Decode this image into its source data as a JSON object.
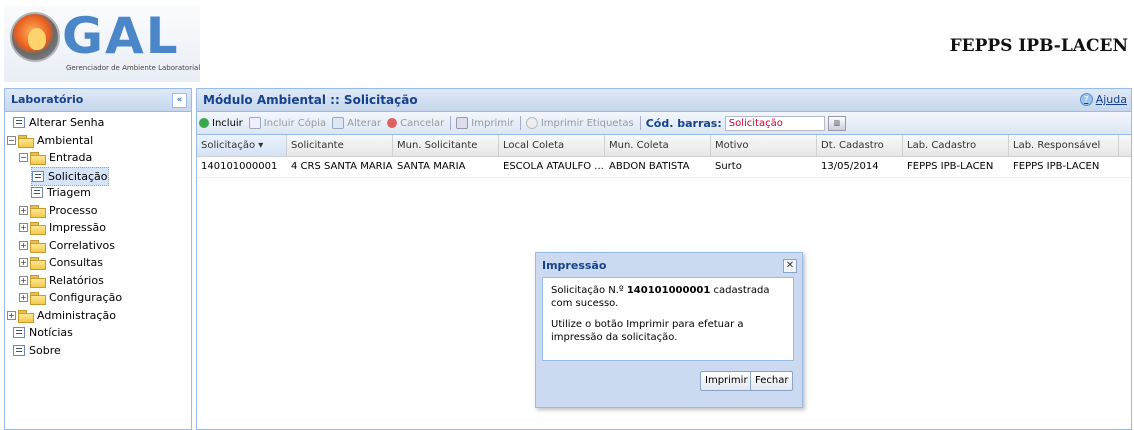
{
  "header": {
    "logo_text": "GAL",
    "logo_subtitle": "Gerenciador de Ambiente Laboratorial",
    "brand": "FEPPS IPB-LACEN"
  },
  "left_panel": {
    "title": "Laboratório",
    "collapse": "«",
    "tree": [
      {
        "label": "Alterar Senha",
        "type": "doc"
      },
      {
        "label": "Ambiental",
        "type": "folder",
        "expander": "−"
      },
      {
        "label": "Entrada",
        "type": "folder",
        "expander": "−"
      },
      {
        "label": "Solicitação",
        "type": "doc",
        "selected": true
      },
      {
        "label": "Triagem",
        "type": "doc"
      },
      {
        "label": "Processo",
        "type": "folder",
        "expander": "+"
      },
      {
        "label": "Impressão",
        "type": "folder",
        "expander": "+"
      },
      {
        "label": "Correlativos",
        "type": "folder",
        "expander": "+"
      },
      {
        "label": "Consultas",
        "type": "folder",
        "expander": "+"
      },
      {
        "label": "Relatórios",
        "type": "folder",
        "expander": "+"
      },
      {
        "label": "Configuração",
        "type": "folder",
        "expander": "+"
      },
      {
        "label": "Administração",
        "type": "folder",
        "expander": "+"
      },
      {
        "label": "Notícias",
        "type": "doc"
      },
      {
        "label": "Sobre",
        "type": "doc"
      }
    ]
  },
  "main": {
    "title": "Módulo Ambiental :: Solicitação",
    "help": "Ajuda",
    "toolbar": {
      "incluir": "Incluir",
      "incluir_copia": "Incluir Cópia",
      "alterar": "Alterar",
      "cancelar": "Cancelar",
      "imprimir": "Imprimir",
      "imprimir_etiquetas": "Imprimir Etiquetas",
      "barcode_label": "Cód. barras:",
      "barcode_value": "Solicitação"
    },
    "grid": {
      "columns": [
        "Solicitação ▾",
        "Solicitante",
        "Mun. Solicitante",
        "Local Coleta",
        "Mun. Coleta",
        "Motivo",
        "Dt. Cadastro",
        "Lab. Cadastro",
        "Lab. Responsável"
      ],
      "rows": [
        [
          "140101000001",
          "4 CRS SANTA MARIA",
          "SANTA MARIA",
          "ESCOLA ATAULFO ...",
          "ABDON BATISTA",
          "Surto",
          "13/05/2014",
          "FEPPS IPB-LACEN",
          "FEPPS IPB-LACEN"
        ]
      ]
    }
  },
  "dialog": {
    "title": "Impressão",
    "close": "✕",
    "msg_prefix": "Solicitação N.º ",
    "msg_number": "140101000001",
    "msg_suffix": " cadastrada com sucesso.",
    "msg2": "Utilize o botão Imprimir para efetuar a impressão da solicitação.",
    "btn_print": "Imprimir",
    "btn_close": "Fechar"
  }
}
